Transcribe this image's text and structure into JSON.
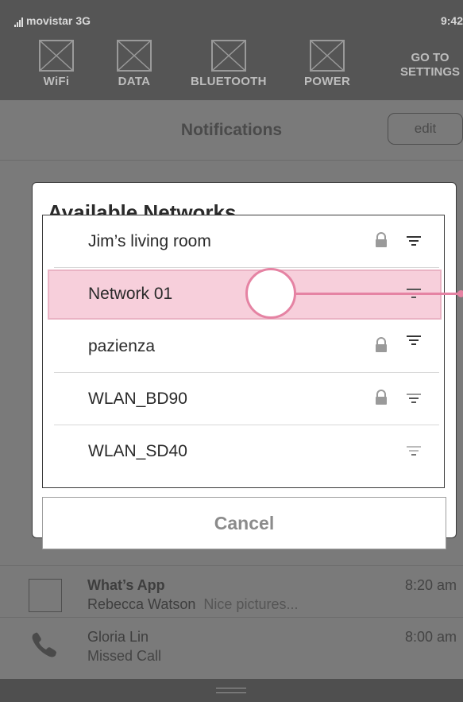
{
  "status_bar": {
    "carrier": "movistar",
    "network": "3G",
    "time": "9:42"
  },
  "quick_settings": {
    "items": [
      {
        "label": "WiFi",
        "icon": "wifi-toggle-icon"
      },
      {
        "label": "DATA",
        "icon": "data-toggle-icon"
      },
      {
        "label": "BLUETOOTH",
        "icon": "bluetooth-toggle-icon"
      },
      {
        "label": "POWER",
        "icon": "power-toggle-icon"
      }
    ],
    "goto_settings": {
      "line1": "GO TO",
      "line2": "SETTINGS"
    }
  },
  "notifications": {
    "title": "Notifications",
    "edit_label": "edit",
    "items": [
      {
        "title": "What’s App",
        "sender": "Rebecca Watson",
        "preview": "Nice pictures...",
        "time": "8:20 am"
      },
      {
        "title": "Gloria Lin",
        "subtitle": "Missed Call",
        "time": "8:00 am"
      }
    ]
  },
  "dialog": {
    "title": "Available Networks",
    "networks": [
      {
        "name": "Jim’s living room",
        "secured": true,
        "selected": false
      },
      {
        "name": "Network 01",
        "secured": false,
        "selected": true
      },
      {
        "name": "pazienza",
        "secured": true,
        "selected": false
      },
      {
        "name": "WLAN_BD90",
        "secured": true,
        "selected": false
      },
      {
        "name": "WLAN_SD40",
        "secured": false,
        "selected": false
      }
    ],
    "cancel_label": "Cancel"
  },
  "colors": {
    "highlight": "#f7cfdb",
    "touch": "#e583a3"
  }
}
